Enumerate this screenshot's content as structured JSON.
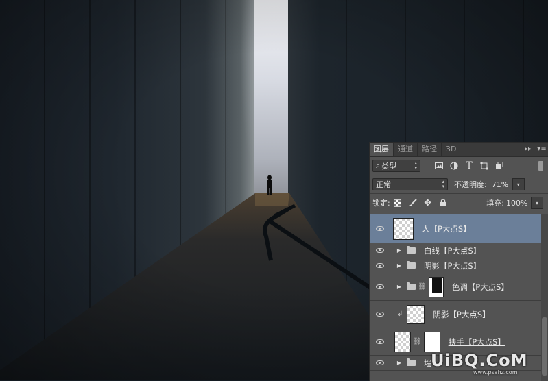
{
  "canvas": {
    "description_icons": [
      "person-silhouette",
      "handrail"
    ]
  },
  "panel": {
    "tabs": [
      {
        "label": "图层",
        "active": true
      },
      {
        "label": "通道",
        "active": false
      },
      {
        "label": "路径",
        "active": false
      },
      {
        "label": "3D",
        "active": false
      }
    ],
    "tab_buttons": {
      "collapse": "▸▸",
      "menu": "▾≡"
    },
    "filter": {
      "label": "类型",
      "icon": "search-icon"
    },
    "filter_icons": [
      "image-filter-icon",
      "adjustment-filter-icon",
      "type-filter-icon",
      "shape-filter-icon",
      "smart-object-filter-icon"
    ],
    "blend_mode": "正常",
    "opacity": {
      "label": "不透明度:",
      "value": "71%"
    },
    "lock": {
      "label": "锁定:"
    },
    "fill": {
      "label": "填充:",
      "value": "100%"
    },
    "layers": [
      {
        "name": "人【P大点S】",
        "kind": "pixel",
        "selected": true
      },
      {
        "name": "白线【P大点S】",
        "kind": "group"
      },
      {
        "name": "阴影【P大点S】",
        "kind": "group"
      },
      {
        "name": "色调【P大点S】",
        "kind": "group-mask"
      },
      {
        "name": "阴影【P大点S】",
        "kind": "clipped-pixel"
      },
      {
        "name": "扶手【P大点S】",
        "kind": "pixel-mask"
      },
      {
        "name": "墙",
        "kind": "group"
      }
    ]
  },
  "watermark": {
    "text": "UiBQ.CoM",
    "sub": "www.psahz.com"
  },
  "colors": {
    "selected_row": "#6b7f99",
    "panel_bg": "#535353"
  }
}
